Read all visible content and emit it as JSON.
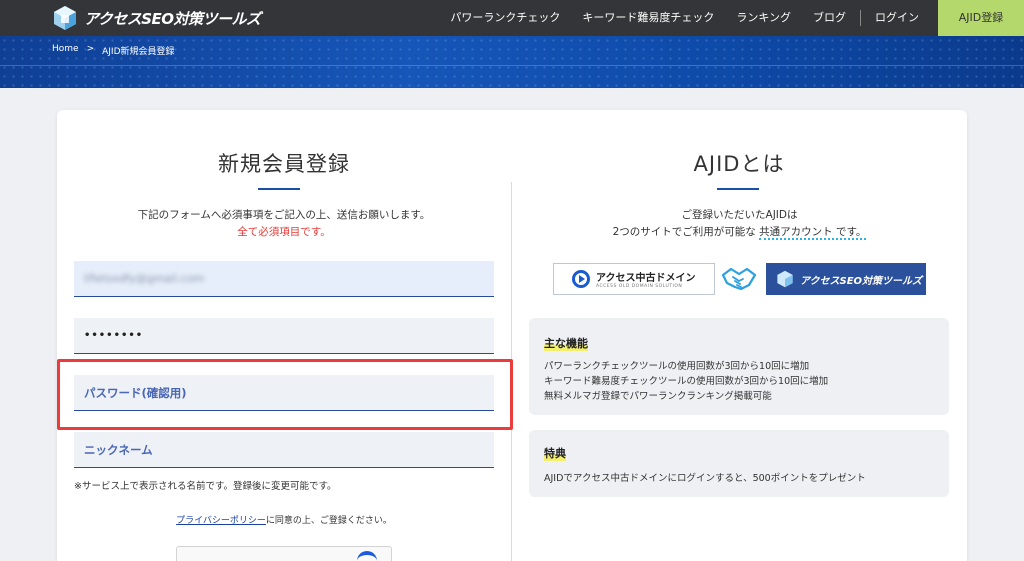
{
  "header": {
    "logo_text": "アクセスSEO対策ツールズ",
    "nav": {
      "power_rank": "パワーランクチェック",
      "keyword_check": "キーワード難易度チェック",
      "ranking": "ランキング",
      "blog": "ブログ",
      "login": "ログイン",
      "register": "AJID登録"
    },
    "colors": {
      "bar": "#333538",
      "register_bg": "#b5d86c",
      "banner": "#1656b8"
    }
  },
  "breadcrumb": {
    "home": "Home",
    "sep": ">",
    "current": "AJID新規会員登録"
  },
  "form": {
    "title": "新規会員登録",
    "intro": "下記のフォームへ必須事項をご記入の上、送信お願いします。",
    "required_note": "全て必須項目です。",
    "email_value": "tfletsxdfy@gmail.com",
    "password_value": "••••••••",
    "password_confirm_placeholder": "パスワード(確認用)",
    "nickname_placeholder": "ニックネーム",
    "nickname_note": "※サービス上で表示される名前です。登録後に変更可能です。",
    "privacy_link": "プライバシーポリシー",
    "privacy_text": "に同意の上、ご登録ください。"
  },
  "about": {
    "title": "AJIDとは",
    "line1": "ご登録いただいたAJIDは",
    "line2_prefix": "2つのサイトでご利用が可能な",
    "line2_highlight": "共通アカウント",
    "line2_suffix": "です。",
    "partner1_name": "アクセス中古ドメイン",
    "partner1_sub": "ACCESS OLD DOMAIN SOLUTION",
    "partner2_name": "アクセスSEO対策ツールズ",
    "features": {
      "title": "主な機能",
      "items": [
        "パワーランクチェックツールの使用回数が3回から10回に増加",
        "キーワード難易度チェックツールの使用回数が3回から10回に増加",
        "無料メルマガ登録でパワーランクランキング掲載可能"
      ]
    },
    "benefits": {
      "title": "特典",
      "text": "AJIDでアクセス中古ドメインにログインすると、500ポイントをプレゼント"
    }
  }
}
